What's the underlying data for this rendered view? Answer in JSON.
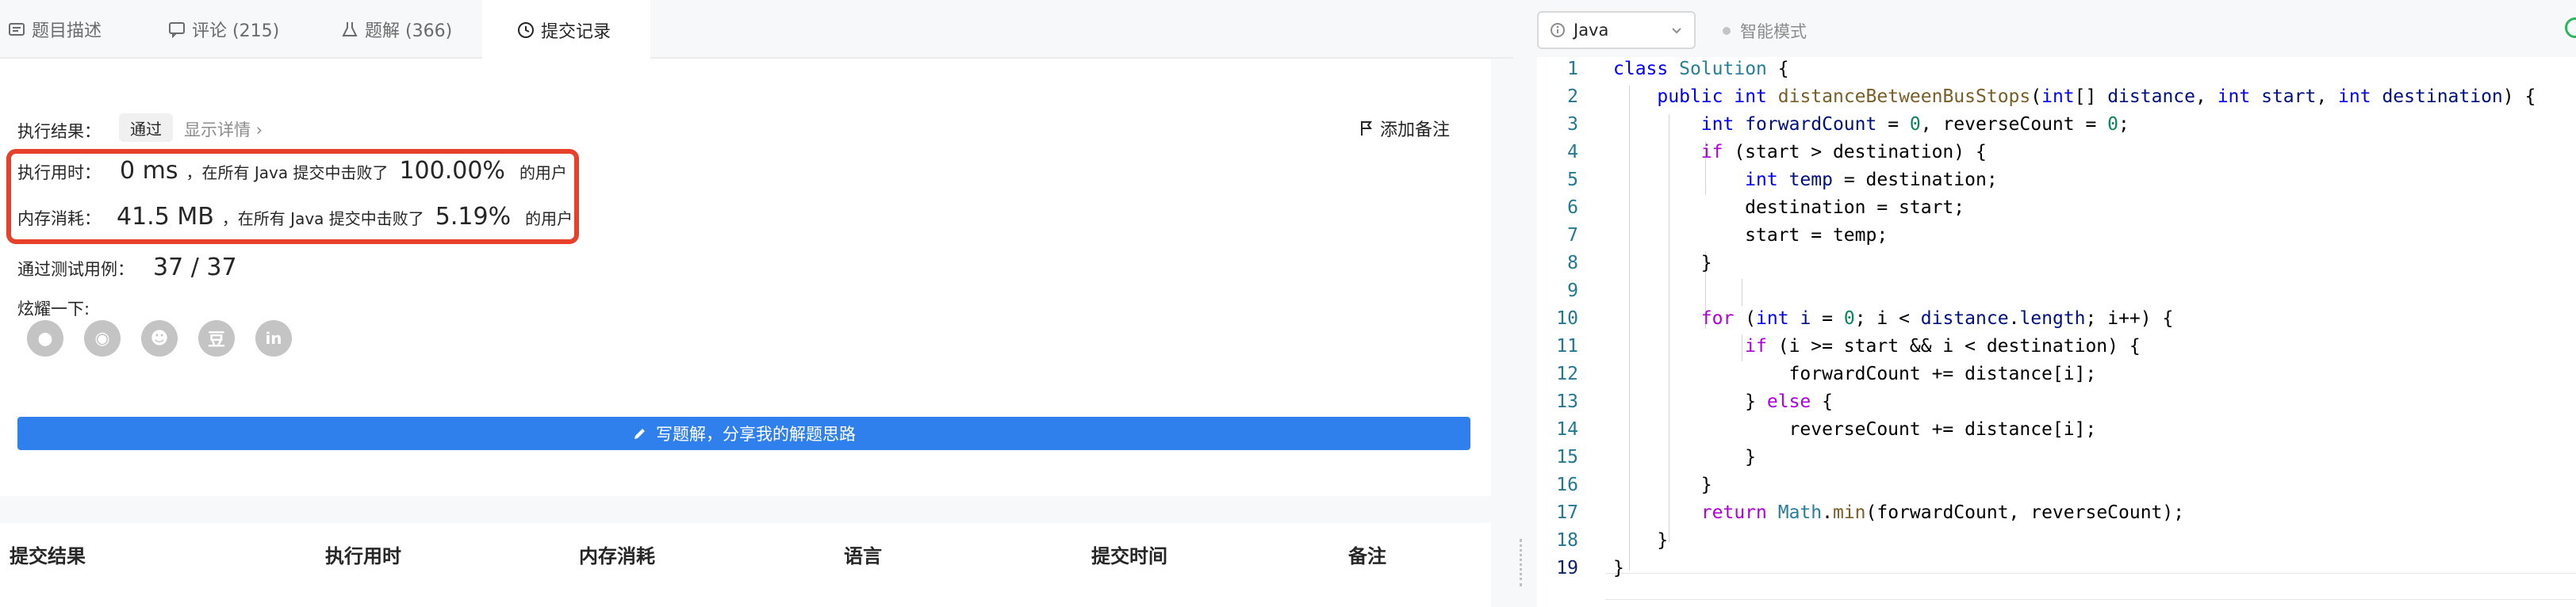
{
  "tabs": [
    {
      "label": "题目描述"
    },
    {
      "label": "评论 (215)"
    },
    {
      "label": "题解 (366)"
    },
    {
      "label": "提交记录"
    }
  ],
  "result": {
    "exec_result_label": "执行结果：",
    "status": "通过",
    "show_details": "显示详情 ›",
    "add_note": "添加备注",
    "time_label": "执行用时：",
    "time_value": "0 ms",
    "time_mid": "，在所有 Java 提交中击败了",
    "time_percent": "100.00%",
    "time_suffix": "的用户",
    "mem_label": "内存消耗：",
    "mem_value": "41.5 MB",
    "mem_mid": "，在所有 Java 提交中击败了",
    "mem_percent": "5.19%",
    "mem_suffix": "的用户",
    "tests_label": "通过测试用例：",
    "tests_value": "37 / 37",
    "share_label": "炫耀一下:",
    "share_icons": [
      "wechat-icon",
      "weibo-icon",
      "qq-icon",
      "douban-icon",
      "linkedin-icon"
    ],
    "write_button": "写题解，分享我的解题思路"
  },
  "table": {
    "headers": [
      "提交结果",
      "执行用时",
      "内存消耗",
      "语言",
      "提交时间",
      "备注"
    ]
  },
  "editor": {
    "language": "Java",
    "smart_mode": "智能模式",
    "line_numbers": [
      "1",
      "2",
      "3",
      "4",
      "5",
      "6",
      "7",
      "8",
      "9",
      "10",
      "11",
      "12",
      "13",
      "14",
      "15",
      "16",
      "17",
      "18",
      "19"
    ]
  },
  "colors": {
    "accent_blue": "#2f80ed",
    "highlight_red": "#e8412b",
    "success_green": "#2db55d"
  }
}
